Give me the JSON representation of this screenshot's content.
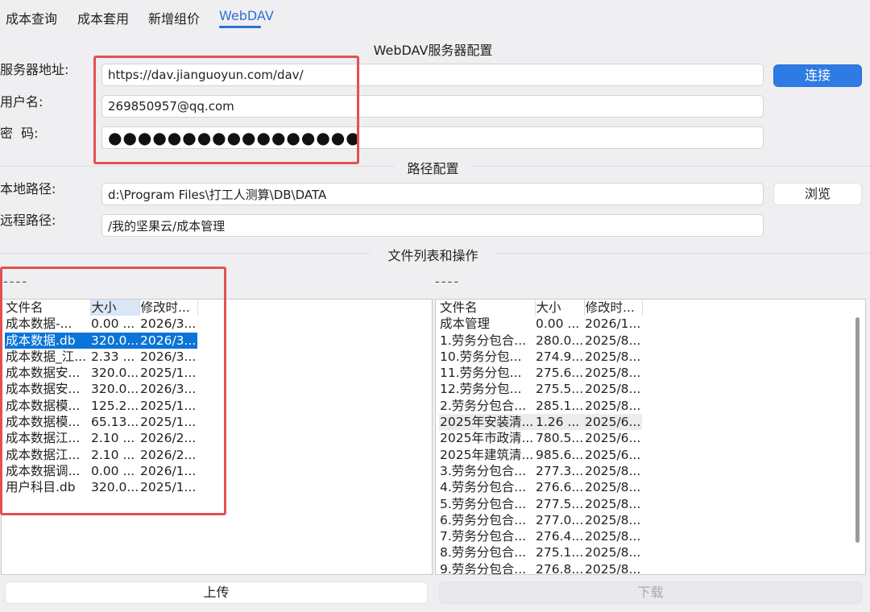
{
  "tabs": [
    {
      "label": "成本查询"
    },
    {
      "label": "成本套用"
    },
    {
      "label": "新增组价"
    },
    {
      "label": "WebDAV"
    }
  ],
  "server_section": {
    "title": "WebDAV服务器配置",
    "address_label": "服务器地址:",
    "address_value": "https://dav.jianguoyun.com/dav/",
    "username_label": "用户名:",
    "username_value": "269850957@qq.com",
    "password_label": "密  码:",
    "password_value": "●●●●●●●●●●●●●●●●●",
    "connect_button": "连接"
  },
  "path_section": {
    "title": "路径配置",
    "local_label": "本地路径:",
    "local_value": "d:\\Program Files\\打工人测算\\DB\\DATA",
    "remote_label": "远程路径:",
    "remote_value": "/我的坚果云/成本管理",
    "browse_button": "浏览"
  },
  "files_section": {
    "title": "文件列表和操作",
    "local_status": "----",
    "remote_status": "----",
    "columns": [
      "文件名",
      "大小",
      "修改时..."
    ],
    "local_files": [
      [
        "成本数据-...",
        "0.00 ...",
        "2026/3..."
      ],
      [
        "成本数据.db",
        "320.0...",
        "2026/3..."
      ],
      [
        "成本数据_江...",
        "2.33 ...",
        "2026/3..."
      ],
      [
        "成本数据安...",
        "320.0...",
        "2025/1..."
      ],
      [
        "成本数据安...",
        "320.0...",
        "2026/3..."
      ],
      [
        "成本数据模...",
        "125.2...",
        "2025/1..."
      ],
      [
        "成本数据模...",
        "65.13...",
        "2025/1..."
      ],
      [
        "成本数据江...",
        "2.10 ...",
        "2026/2..."
      ],
      [
        "成本数据江...",
        "2.10 ...",
        "2026/2..."
      ],
      [
        "成本数据调...",
        "0.00 ...",
        "2026/1..."
      ],
      [
        "用户科目.db",
        "320.0...",
        "2025/1..."
      ]
    ],
    "remote_files": [
      [
        "成本管理",
        "0.00 ...",
        "2026/1..."
      ],
      [
        "1.劳务分包合...",
        "280.0...",
        "2025/8..."
      ],
      [
        "10.劳务分包...",
        "274.9...",
        "2025/8..."
      ],
      [
        "11.劳务分包...",
        "275.6...",
        "2025/8..."
      ],
      [
        "12.劳务分包...",
        "275.5...",
        "2025/8..."
      ],
      [
        "2.劳务分包合...",
        "285.1...",
        "2025/8..."
      ],
      [
        "2025年安装清...",
        "1.26 ...",
        "2025/6..."
      ],
      [
        "2025年市政清...",
        "780.5...",
        "2025/6..."
      ],
      [
        "2025年建筑清...",
        "985.6...",
        "2025/6..."
      ],
      [
        "3.劳务分包合...",
        "277.3...",
        "2025/8..."
      ],
      [
        "4.劳务分包合...",
        "276.6...",
        "2025/8..."
      ],
      [
        "5.劳务分包合...",
        "277.5...",
        "2025/8..."
      ],
      [
        "6.劳务分包合...",
        "277.0...",
        "2025/8..."
      ],
      [
        "7.劳务分包合...",
        "276.4...",
        "2025/8..."
      ],
      [
        "8.劳务分包合...",
        "275.1...",
        "2025/8..."
      ],
      [
        "9.劳务分包合...",
        "276.8...",
        "2025/8..."
      ]
    ],
    "upload_button": "上传",
    "download_button": "下载"
  },
  "colors": {
    "accent": "#2f7be5",
    "selection": "#0a74d8",
    "annotation_red": "#e25151"
  }
}
